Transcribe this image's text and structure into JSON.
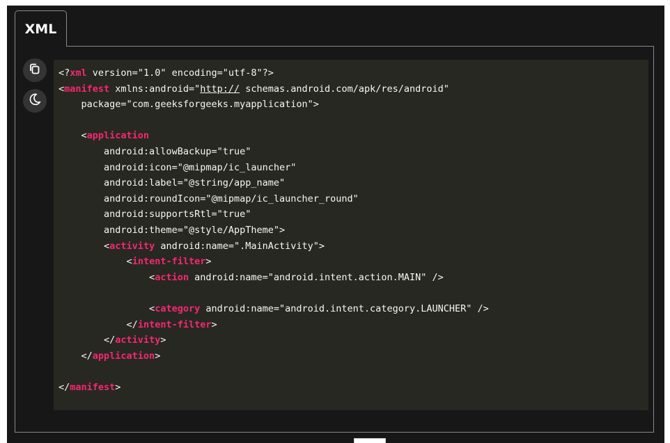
{
  "tab": {
    "label": "XML"
  },
  "toolbar": {
    "copy_icon": "copy-icon",
    "theme_icon": "moon-icon"
  },
  "code": {
    "language": "XML",
    "lines": [
      {
        "indent": "",
        "parts": [
          [
            "pn",
            "<?"
          ],
          [
            "tg",
            "xml"
          ],
          [
            "at",
            " version="
          ],
          [
            "st",
            "\"1.0\""
          ],
          [
            "at",
            " encoding="
          ],
          [
            "st",
            "\"utf-8\""
          ],
          [
            "pn",
            "?>"
          ]
        ]
      },
      {
        "indent": "",
        "parts": [
          [
            "pn",
            "<"
          ],
          [
            "tg",
            "manifest"
          ],
          [
            "at",
            " xmlns:android="
          ],
          [
            "st",
            "\""
          ],
          [
            "url",
            "http://"
          ],
          [
            "st",
            " schemas.android.com/apk/res/android\""
          ]
        ]
      },
      {
        "indent": "    ",
        "parts": [
          [
            "at",
            "package="
          ],
          [
            "st",
            "\"com.geeksforgeeks.myapplication\""
          ],
          [
            "pn",
            ">"
          ]
        ]
      },
      {
        "indent": "",
        "parts": []
      },
      {
        "indent": "    ",
        "parts": [
          [
            "pn",
            "<"
          ],
          [
            "tg",
            "application"
          ]
        ]
      },
      {
        "indent": "        ",
        "parts": [
          [
            "at",
            "android:allowBackup="
          ],
          [
            "st",
            "\"true\""
          ]
        ]
      },
      {
        "indent": "        ",
        "parts": [
          [
            "at",
            "android:icon="
          ],
          [
            "st",
            "\"@mipmap/ic_launcher\""
          ]
        ]
      },
      {
        "indent": "        ",
        "parts": [
          [
            "at",
            "android:label="
          ],
          [
            "st",
            "\"@string/app_name\""
          ]
        ]
      },
      {
        "indent": "        ",
        "parts": [
          [
            "at",
            "android:roundIcon="
          ],
          [
            "st",
            "\"@mipmap/ic_launcher_round\""
          ]
        ]
      },
      {
        "indent": "        ",
        "parts": [
          [
            "at",
            "android:supportsRtl="
          ],
          [
            "st",
            "\"true\""
          ]
        ]
      },
      {
        "indent": "        ",
        "parts": [
          [
            "at",
            "android:theme="
          ],
          [
            "st",
            "\"@style/AppTheme\""
          ],
          [
            "pn",
            ">"
          ]
        ]
      },
      {
        "indent": "        ",
        "parts": [
          [
            "pn",
            "<"
          ],
          [
            "tg",
            "activity"
          ],
          [
            "at",
            " android:name="
          ],
          [
            "st",
            "\".MainActivity\""
          ],
          [
            "pn",
            ">"
          ]
        ]
      },
      {
        "indent": "            ",
        "parts": [
          [
            "pn",
            "<"
          ],
          [
            "tg",
            "intent-filter"
          ],
          [
            "pn",
            ">"
          ]
        ]
      },
      {
        "indent": "                ",
        "parts": [
          [
            "pn",
            "<"
          ],
          [
            "tg",
            "action"
          ],
          [
            "at",
            " android:name="
          ],
          [
            "st",
            "\"android.intent.action.MAIN\""
          ],
          [
            "pn",
            " />"
          ]
        ]
      },
      {
        "indent": "",
        "parts": []
      },
      {
        "indent": "                ",
        "parts": [
          [
            "pn",
            "<"
          ],
          [
            "tg",
            "category"
          ],
          [
            "at",
            " android:name="
          ],
          [
            "st",
            "\"android.intent.category.LAUNCHER\""
          ],
          [
            "pn",
            " />"
          ]
        ]
      },
      {
        "indent": "            ",
        "parts": [
          [
            "pn",
            "</"
          ],
          [
            "tg",
            "intent-filter"
          ],
          [
            "pn",
            ">"
          ]
        ]
      },
      {
        "indent": "        ",
        "parts": [
          [
            "pn",
            "</"
          ],
          [
            "tg",
            "activity"
          ],
          [
            "pn",
            ">"
          ]
        ]
      },
      {
        "indent": "    ",
        "parts": [
          [
            "pn",
            "</"
          ],
          [
            "tg",
            "application"
          ],
          [
            "pn",
            ">"
          ]
        ]
      },
      {
        "indent": "",
        "parts": []
      },
      {
        "indent": "",
        "parts": [
          [
            "pn",
            "</"
          ],
          [
            "tg",
            "manifest"
          ],
          [
            "pn",
            ">"
          ]
        ]
      }
    ]
  },
  "colors": {
    "background": "#171717",
    "code_background": "#272822",
    "tag": "#f92672",
    "text": "#f8f8f2",
    "border": "#8a8a8a"
  }
}
